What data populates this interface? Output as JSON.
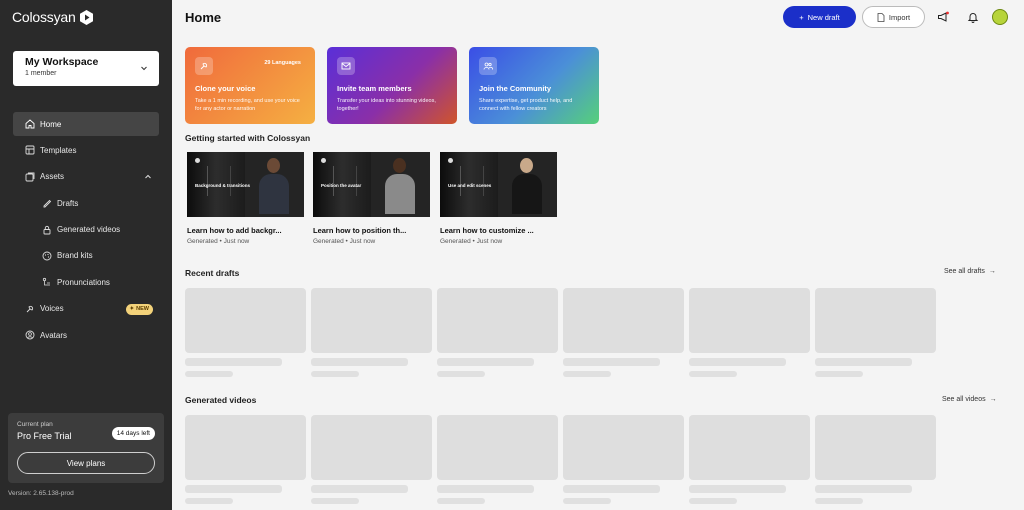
{
  "brand": {
    "name": "Colossyan"
  },
  "workspace": {
    "name": "My Workspace",
    "members": "1 member"
  },
  "sidebar": {
    "items": [
      {
        "label": "Home",
        "icon": "home-icon"
      },
      {
        "label": "Templates",
        "icon": "templates-icon"
      },
      {
        "label": "Assets",
        "icon": "assets-icon"
      },
      {
        "label": "Drafts",
        "icon": "drafts-icon"
      },
      {
        "label": "Generated videos",
        "icon": "lock-icon"
      },
      {
        "label": "Brand kits",
        "icon": "palette-icon"
      },
      {
        "label": "Pronunciations",
        "icon": "pronunciation-icon"
      },
      {
        "label": "Voices",
        "icon": "voice-icon",
        "badge": "NEW"
      },
      {
        "label": "Avatars",
        "icon": "avatar-icon"
      }
    ]
  },
  "plan": {
    "label": "Current plan",
    "name": "Pro Free Trial",
    "days_left": "14 days left",
    "button": "View plans"
  },
  "version": "Version: 2.65.138-prod",
  "header": {
    "title": "Home",
    "new_draft": "New draft",
    "import": "Import"
  },
  "promos": [
    {
      "title": "Clone your voice",
      "desc": "Take a 1 min recording, and use your voice for any actor or narration",
      "tag": "29 Languages"
    },
    {
      "title": "Invite team members",
      "desc": "Transfer your ideas into stunning videos, together!"
    },
    {
      "title": "Join the Community",
      "desc": "Share expertise, get product help, and connect with fellow creators"
    }
  ],
  "getting_started": {
    "title": "Getting started with Colossyan",
    "videos": [
      {
        "title": "Learn how to add backgr...",
        "meta": "Generated • Just now",
        "thumb_label": "Background & transitions"
      },
      {
        "title": "Learn how to position th...",
        "meta": "Generated • Just now",
        "thumb_label": "Position the avatar"
      },
      {
        "title": "Learn how to customize ...",
        "meta": "Generated • Just now",
        "thumb_label": "Use and edit scenes"
      }
    ]
  },
  "recent_drafts": {
    "title": "Recent drafts",
    "see_all": "See all drafts"
  },
  "generated_videos": {
    "title": "Generated videos",
    "see_all": "See all videos"
  },
  "colors": {
    "primary": "#1b2fc9",
    "sidebar_bg": "#2a2a2a",
    "avatar": "#b7d43a"
  }
}
